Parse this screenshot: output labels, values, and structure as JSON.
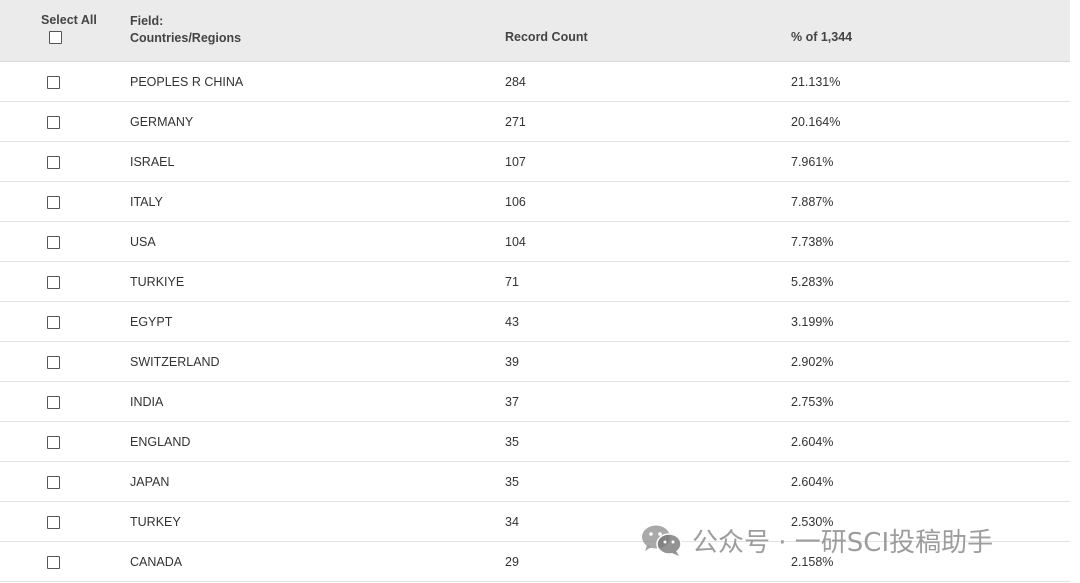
{
  "header": {
    "select_all": "Select All",
    "field_label": "Field:",
    "field_name": "Countries/Regions",
    "record_count": "Record Count",
    "percent": "% of 1,344"
  },
  "rows": [
    {
      "name": "PEOPLES R CHINA",
      "count": "284",
      "pct": "21.131%"
    },
    {
      "name": "GERMANY",
      "count": "271",
      "pct": "20.164%"
    },
    {
      "name": "ISRAEL",
      "count": "107",
      "pct": "7.961%"
    },
    {
      "name": "ITALY",
      "count": "106",
      "pct": "7.887%"
    },
    {
      "name": "USA",
      "count": "104",
      "pct": "7.738%"
    },
    {
      "name": "TURKIYE",
      "count": "71",
      "pct": "5.283%"
    },
    {
      "name": "EGYPT",
      "count": "43",
      "pct": "3.199%"
    },
    {
      "name": "SWITZERLAND",
      "count": "39",
      "pct": "2.902%"
    },
    {
      "name": "INDIA",
      "count": "37",
      "pct": "2.753%"
    },
    {
      "name": "ENGLAND",
      "count": "35",
      "pct": "2.604%"
    },
    {
      "name": "JAPAN",
      "count": "35",
      "pct": "2.604%"
    },
    {
      "name": "TURKEY",
      "count": "34",
      "pct": "2.530%"
    },
    {
      "name": "CANADA",
      "count": "29",
      "pct": "2.158%"
    }
  ],
  "watermark": {
    "icon": "wechat-icon",
    "text": "公众号 · 一研SCI投稿助手"
  }
}
